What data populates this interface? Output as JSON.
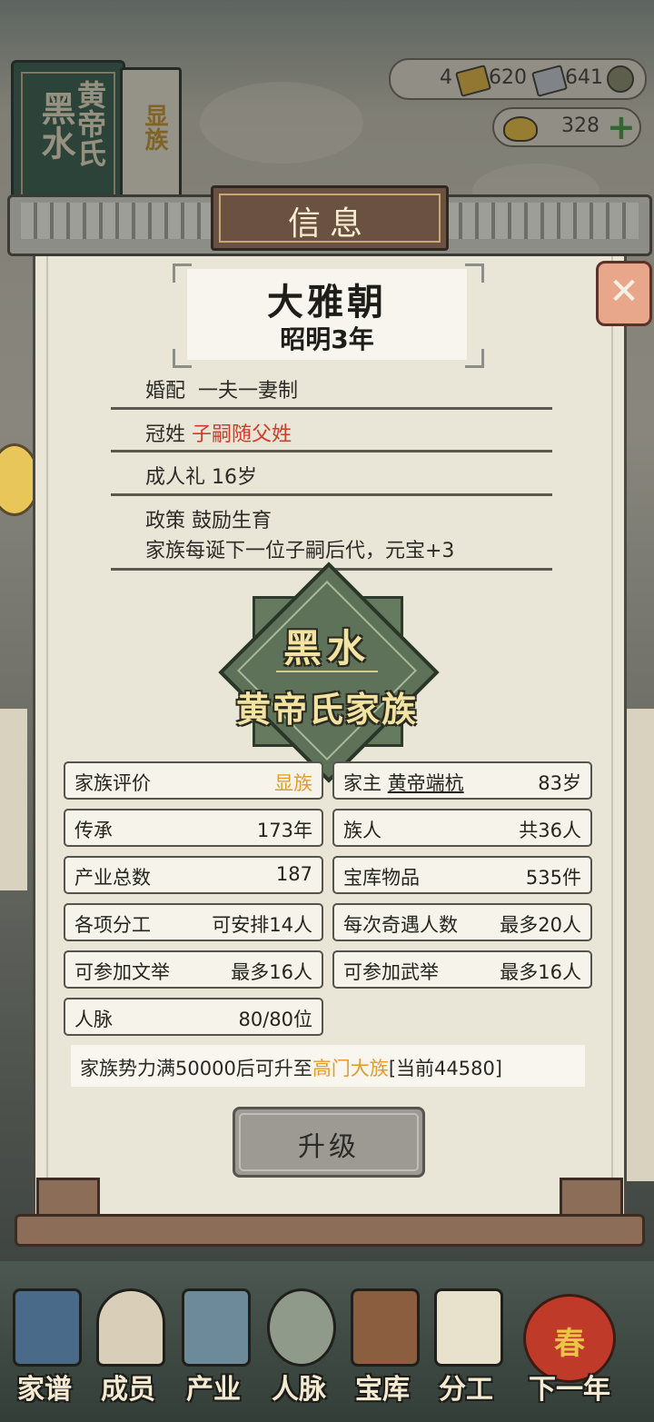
{
  "book": {
    "line1": "黑水",
    "line2": "黄帝氏",
    "line3": "显族"
  },
  "resources": {
    "r1": "4",
    "r2": "620",
    "r3": "641",
    "gold": "328"
  },
  "panel_title": "信息",
  "dynasty": {
    "name": "大雅朝",
    "year": "昭明3年"
  },
  "rules": {
    "marriage_label": "婚配",
    "marriage_value": "一夫一妻制",
    "surname_label": "冠姓",
    "surname_value": "子嗣随父姓",
    "adult_label": "成人礼",
    "adult_value": "16岁",
    "policy_label": "政策",
    "policy_value": "鼓励生育",
    "policy_desc": "家族每诞下一位子嗣后代，元宝+3"
  },
  "emblem": {
    "line1": "黑水",
    "line2": "黄帝氏家族"
  },
  "stats": [
    {
      "label": "家族评价",
      "value": "显族"
    },
    {
      "label": "家主",
      "name": "黄帝端杭",
      "value": "83岁"
    },
    {
      "label": "传承",
      "value": "173年"
    },
    {
      "label": "族人",
      "value": "共36人"
    },
    {
      "label": "产业总数",
      "value": "187"
    },
    {
      "label": "宝库物品",
      "value": "535件"
    },
    {
      "label": "各项分工",
      "value": "可安排14人"
    },
    {
      "label": "每次奇遇人数",
      "value": "最多20人"
    },
    {
      "label": "可参加文举",
      "value": "最多16人"
    },
    {
      "label": "可参加武举",
      "value": "最多16人"
    },
    {
      "label": "人脉",
      "value": "80/80位"
    }
  ],
  "upgrade": {
    "pre": "家族势力满50000后可升至",
    "target": "高门大族",
    "post": "[当前44580]",
    "button": "升级"
  },
  "nav": [
    "家谱",
    "成员",
    "产业",
    "人脉",
    "宝库",
    "分工",
    "下一年"
  ],
  "lantern": "春",
  "colors": {
    "accent_orange": "#e59a2a",
    "red": "#d23a2a",
    "emblem_green": "#5d7258"
  }
}
